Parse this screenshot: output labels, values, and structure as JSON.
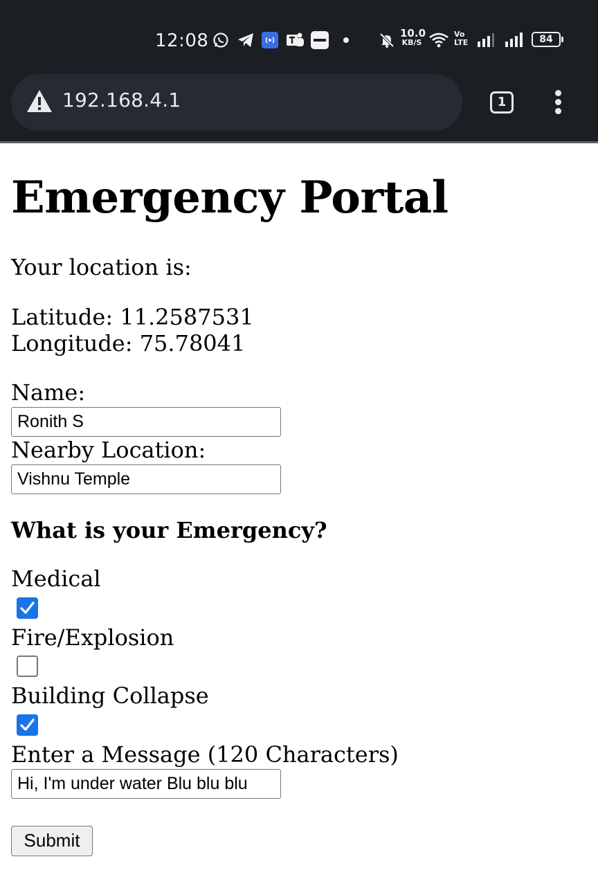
{
  "status_bar": {
    "time": "12:08",
    "net_speed_value": "10.0",
    "net_speed_unit": "KB/S",
    "volte_top": "Vo",
    "volte_bottom": "LTE",
    "battery": "84",
    "icons": [
      "whatsapp-icon",
      "telegram-icon",
      "hotspot-icon",
      "teams-icon",
      "zomato-icon",
      "dot-icon",
      "mute-icon",
      "wifi-icon",
      "signal-icon",
      "signal-icon",
      "battery-icon"
    ]
  },
  "browser": {
    "url": "192.168.4.1",
    "tab_count": "1"
  },
  "page": {
    "title": "Emergency Portal",
    "location_label": "Your location is:",
    "latitude": "Latitude: 11.2587531",
    "longitude": "Longitude: 75.78041",
    "name_label": "Name:",
    "name_value": "Ronith S",
    "nearby_label": "Nearby Location:",
    "nearby_value": "Vishnu Temple",
    "question": "What is your Emergency?",
    "options": [
      {
        "label": "Medical",
        "checked": true
      },
      {
        "label": "Fire/Explosion",
        "checked": false
      },
      {
        "label": "Building Collapse",
        "checked": true
      }
    ],
    "message_label": "Enter a Message (120 Characters)",
    "message_value": "Hi, I'm under water Blu blu blu",
    "submit_label": "Submit"
  },
  "colors": {
    "chrome_bg": "#1b1f24",
    "pill_bg": "#262b33",
    "checkbox_checked": "#1a73e8",
    "input_border": "#767676"
  }
}
